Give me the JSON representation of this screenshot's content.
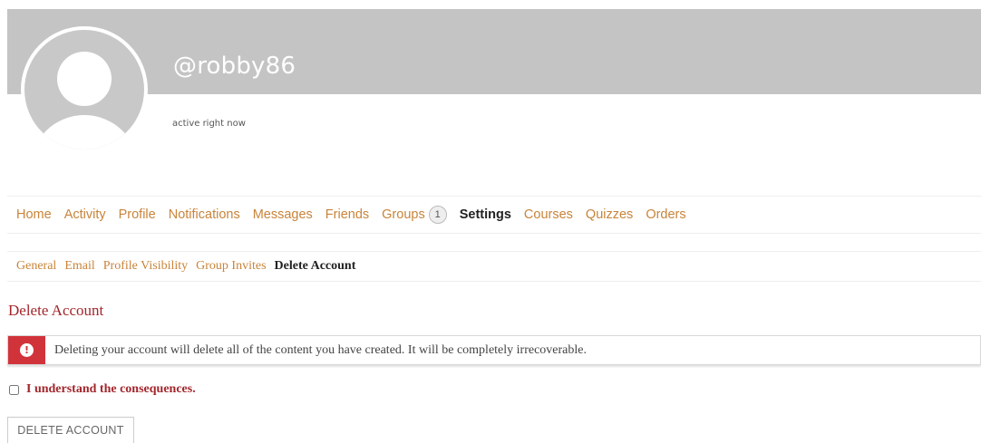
{
  "profile": {
    "username": "@robby86",
    "status": "active right now"
  },
  "nav": {
    "items": [
      {
        "label": "Home"
      },
      {
        "label": "Activity"
      },
      {
        "label": "Profile"
      },
      {
        "label": "Notifications"
      },
      {
        "label": "Messages"
      },
      {
        "label": "Friends"
      },
      {
        "label": "Groups",
        "count": "1"
      },
      {
        "label": "Settings",
        "active": true
      },
      {
        "label": "Courses"
      },
      {
        "label": "Quizzes"
      },
      {
        "label": "Orders"
      }
    ]
  },
  "subnav": {
    "items": [
      {
        "label": "General"
      },
      {
        "label": "Email"
      },
      {
        "label": "Profile Visibility"
      },
      {
        "label": "Group Invites"
      },
      {
        "label": "Delete Account",
        "active": true
      }
    ]
  },
  "section": {
    "title": "Delete Account"
  },
  "alert": {
    "message": "Deleting your account will delete all of the content you have created. It will be completely irrecoverable.",
    "icon": "exclamation-icon"
  },
  "consent": {
    "label": "I understand the consequences.",
    "checked": false
  },
  "actions": {
    "delete_label": "DELETE ACCOUNT"
  },
  "colors": {
    "link": "#c8843a",
    "danger": "#a3262c",
    "alert_icon_bg": "#d1333b",
    "cover": "#c4c4c4"
  }
}
